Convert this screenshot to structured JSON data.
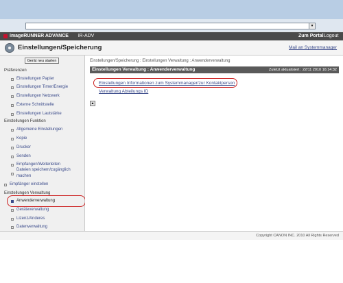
{
  "topbar": {
    "product": "imageRUNNER ADVANCE",
    "model": "iR-ADV",
    "zum_portal": "Zum Portal",
    "logout": "Logout"
  },
  "header": {
    "title": "Einstellungen/Speicherung",
    "mail_link": "Mail an Systemmanager"
  },
  "sidebar": {
    "restart_button": "Gerät neu starten",
    "section_praeferenzen": "Präferenzen",
    "praeferenzen_items": [
      "Einstellungen Papier",
      "Einstellungen Timer/Energie",
      "Einstellungen Netzwerk",
      "Externe Schnittstelle",
      "Einstellungen Lautstärke"
    ],
    "section_funktion": "Einstellungen Funktion",
    "funktion_items": [
      "Allgemeine Einstellungen",
      "Kopie",
      "Drucker",
      "Senden",
      "Empfangen/Weiterleiten",
      "Dateien speichern/zugänglich machen"
    ],
    "empfaenger": "Empfänger einstellen",
    "section_verwaltung": "Einstellungen Verwaltung",
    "verwaltung_items": [
      "Anwenderverwaltung",
      "Geräteverwaltung",
      "Lizenz/Anderes",
      "Datenverwaltung"
    ]
  },
  "main": {
    "breadcrumb": "Einstellungen/Speicherung : Einstellungen Verwaltung : Anwenderverwaltung",
    "section_title": "Einstellungen Verwaltung : Anwenderverwaltung",
    "updated": "Zuletzt aktualisiert : 22/11 2010 16:14:32",
    "link_contact": "Einstellungen Informationen zum Systemmanager/zur Kontaktperson",
    "link_dept": "Verwaltung Abteilungs ID",
    "scroll_top": "▲"
  },
  "footer": {
    "copyright": "Copyright CANON INC. 2010 All Rights Reserved"
  }
}
